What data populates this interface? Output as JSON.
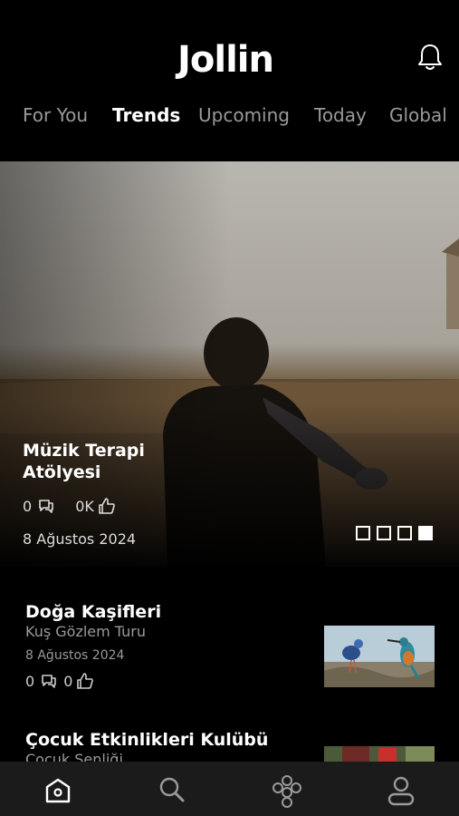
{
  "app": {
    "logo_text": "Jollin"
  },
  "tabs": [
    {
      "label": "For You",
      "active": false
    },
    {
      "label": "Trends",
      "active": true
    },
    {
      "label": "Upcoming",
      "active": false
    },
    {
      "label": "Today",
      "active": false
    },
    {
      "label": "Global",
      "active": false
    }
  ],
  "hero": {
    "title": "Müzik Terapi Atölyesi",
    "comments": "0",
    "likes": "0K",
    "date": "8 Ağustos 2024",
    "pager": {
      "total": 4,
      "active": 4
    }
  },
  "events": [
    {
      "title": "Doğa Kaşifleri",
      "subtitle": "Kuş Gözlem Turu",
      "date": "8 Ağustos 2024",
      "comments": "0",
      "likes": "0"
    },
    {
      "title": "Çocuk Etkinlikleri Kulübü",
      "subtitle": "Çocuk Şenliği"
    }
  ],
  "nav": [
    {
      "icon": "home-icon",
      "active": true
    },
    {
      "icon": "search-icon",
      "active": false
    },
    {
      "icon": "community-icon",
      "active": false
    },
    {
      "icon": "profile-icon",
      "active": false
    }
  ],
  "colors": {
    "background": "#000000",
    "muted_text": "#9a9a9a",
    "nav_bg": "#1b1b1b"
  }
}
